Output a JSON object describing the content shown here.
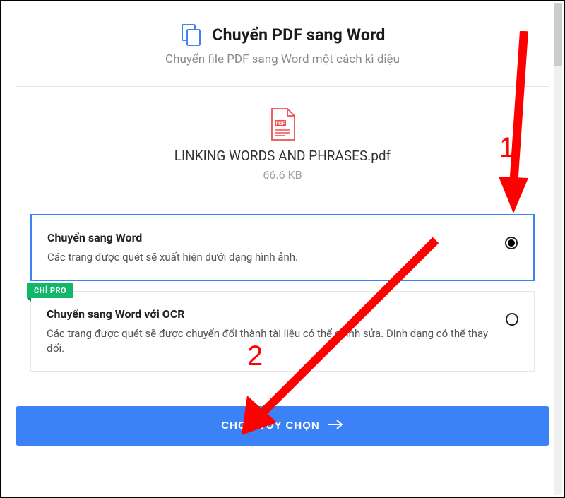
{
  "header": {
    "title": "Chuyển PDF sang Word",
    "subtitle": "Chuyển file PDF sang Word một cách kì diệu"
  },
  "file": {
    "name": "LINKING WORDS AND PHRASES.pdf",
    "size": "66.6 KB",
    "icon_badge": "PDF"
  },
  "options": [
    {
      "title": "Chuyển sang Word",
      "desc": "Các trang được quét sẽ xuất hiện dưới dạng hình ảnh.",
      "selected": true,
      "pro": false
    },
    {
      "title": "Chuyển sang Word với OCR",
      "desc": "Các trang được quét sẽ được chuyển đổi thành tài liệu có thể chỉnh sửa. Định dạng có thể thay đổi.",
      "selected": false,
      "pro": true,
      "pro_label": "CHỈ PRO"
    }
  ],
  "primary_button": "CHỌN TÙY CHỌN",
  "annotations": {
    "one": "1",
    "two": "2"
  },
  "colors": {
    "accent": "#3b82f6",
    "annotation": "#ff0000",
    "pro_badge": "#12b76a"
  }
}
